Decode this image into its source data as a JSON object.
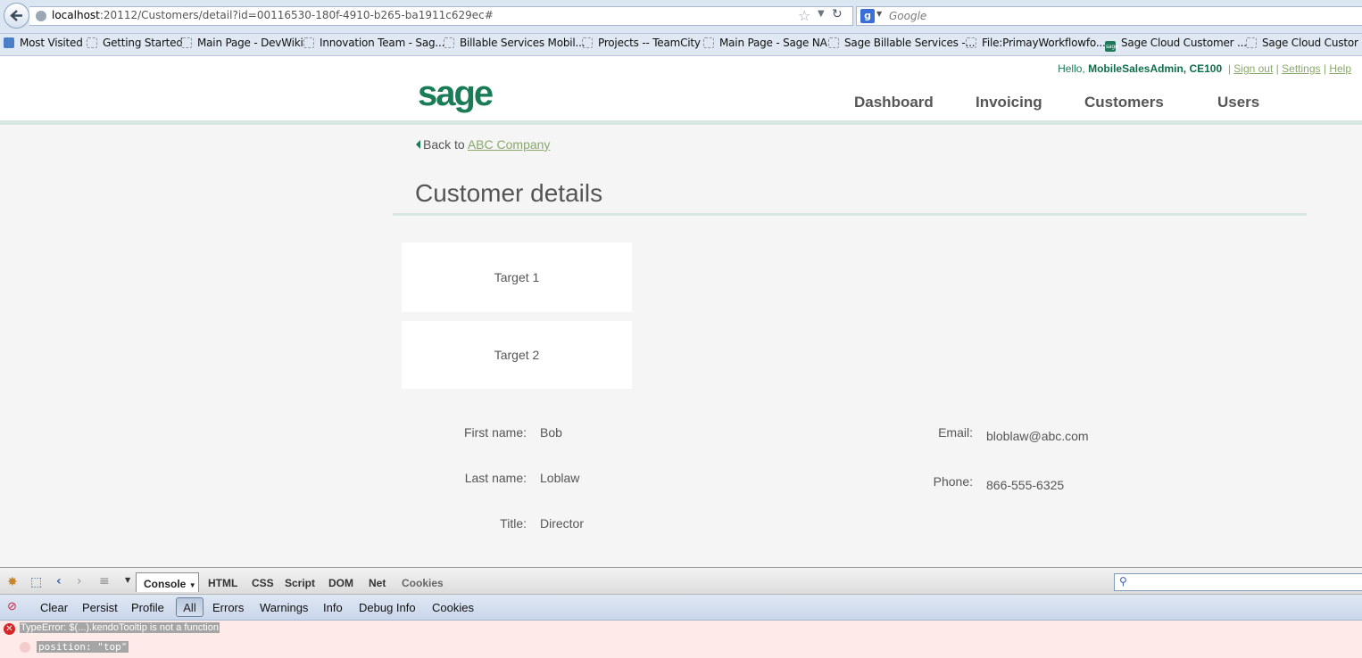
{
  "browser": {
    "url_host": "localhost",
    "url_rest": ":20112/Customers/detail?id=00116530-180f-4910-b265-ba1911c629ec#",
    "search_engine_placeholder": "Google",
    "bookmarks": [
      {
        "label": "Most Visited",
        "icon": "most-visited-icon"
      },
      {
        "label": "Getting Started",
        "icon": "page-icon"
      },
      {
        "label": "Main Page - DevWiki",
        "icon": "page-icon"
      },
      {
        "label": "Innovation Team - Sag...",
        "icon": "page-icon"
      },
      {
        "label": "Billable Services Mobil...",
        "icon": "page-icon"
      },
      {
        "label": "Projects -- TeamCity",
        "icon": "page-icon"
      },
      {
        "label": "Main Page - Sage NA",
        "icon": "page-icon"
      },
      {
        "label": "Sage Billable Services -...",
        "icon": "page-icon"
      },
      {
        "label": "File:PrimayWorkflowfo...",
        "icon": "page-icon"
      },
      {
        "label": "Sage Cloud Customer ...",
        "icon": "sage-favicon"
      },
      {
        "label": "Sage Cloud Custor",
        "icon": "page-icon"
      }
    ]
  },
  "header": {
    "hello": "Hello,",
    "user": "MobileSalesAdmin, CE100",
    "sign_out": "Sign out",
    "settings": "Settings",
    "help": "Help",
    "logo": "sage",
    "nav": [
      "Dashboard",
      "Invoicing",
      "Customers",
      "Users"
    ]
  },
  "content": {
    "back_prefix": "Back to",
    "back_link": "ABC Company",
    "title": "Customer details",
    "targets": [
      "Target 1",
      "Target 2"
    ],
    "fields": {
      "first_name_label": "First name:",
      "first_name": "Bob",
      "last_name_label": "Last name:",
      "last_name": "Loblaw",
      "title_label": "Title:",
      "title": "Director",
      "email_label": "Email:",
      "email": "bloblaw@abc.com",
      "phone_label": "Phone:",
      "phone": "866-555-6325"
    }
  },
  "firebug": {
    "tabs": [
      "Console",
      "HTML",
      "CSS",
      "Script",
      "DOM",
      "Net",
      "Cookies"
    ],
    "filters": [
      "Clear",
      "Persist",
      "Profile",
      "All",
      "Errors",
      "Warnings",
      "Info",
      "Debug Info",
      "Cookies"
    ],
    "error_message": "TypeError: $(...).kendoTooltip is not a function",
    "error_code": "position: \"top\""
  },
  "colors": {
    "brand": "#1a7b57",
    "link": "#8aa86c",
    "error_bg": "#ffeaea"
  }
}
